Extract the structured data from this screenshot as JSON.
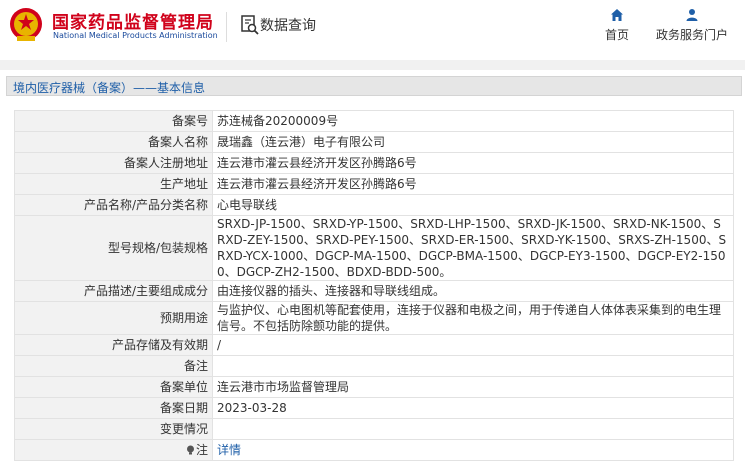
{
  "header": {
    "title": "国家药品监督管理局",
    "subtitle": "National Medical Products Administration",
    "query_label": "数据查询",
    "nav": {
      "home": "首页",
      "service": "政务服务门户"
    }
  },
  "breadcrumb": "境内医疗器械（备案）——基本信息",
  "rows": [
    {
      "label": "备案号",
      "value": "苏连械备20200009号"
    },
    {
      "label": "备案人名称",
      "value": "晟瑞鑫（连云港）电子有限公司"
    },
    {
      "label": "备案人注册地址",
      "value": "连云港市灌云县经济开发区孙腾路6号"
    },
    {
      "label": "生产地址",
      "value": "连云港市灌云县经济开发区孙腾路6号"
    },
    {
      "label": "产品名称/产品分类名称",
      "value": "心电导联线"
    },
    {
      "label": "型号规格/包装规格",
      "value": "SRXD-JP-1500、SRXD-YP-1500、SRXD-LHP-1500、SRXD-JK-1500、SRXD-NK-1500、SRXD-ZEY-1500、SRXD-PEY-1500、SRXD-ER-1500、SRXD-YK-1500、SRXS-ZH-1500、SRXD-YCX-1000、DGCP-MA-1500、DGCP-BMA-1500、DGCP-EY3-1500、DGCP-EY2-1500、DGCP-ZH2-1500、BDXD-BDD-500。"
    },
    {
      "label": "产品描述/主要组成成分",
      "value": "由连接仪器的插头、连接器和导联线组成。"
    },
    {
      "label": "预期用途",
      "value": "与监护仪、心电图机等配套使用，连接于仪器和电极之间，用于传递自人体体表采集到的电生理信号。不包括防除颤功能的提供。"
    },
    {
      "label": "产品存储及有效期",
      "value": "/"
    },
    {
      "label": "备注",
      "value": ""
    },
    {
      "label": "备案单位",
      "value": "连云港市市场监督管理局"
    },
    {
      "label": "备案日期",
      "value": "2023-03-28"
    },
    {
      "label": "变更情况",
      "value": ""
    },
    {
      "label": "注",
      "value": "详情"
    }
  ],
  "colors": {
    "brand_red": "#d0021b",
    "brand_blue": "#1a4a9c",
    "link_blue": "#1f5fa8"
  },
  "icons": [
    "national-emblem-icon",
    "data-query-icon",
    "home-icon",
    "user-icon",
    "note-icon"
  ]
}
